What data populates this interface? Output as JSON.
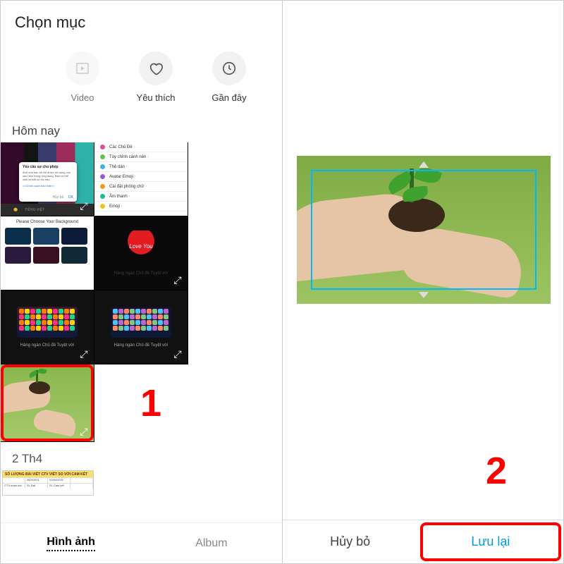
{
  "left": {
    "title": "Chọn mục",
    "categories": {
      "video": "Video",
      "favorites": "Yêu thích",
      "recent": "Gần đây"
    },
    "section_today": "Hôm nay",
    "dialog": {
      "title": "Yêu cầu sự cho phép",
      "body": "Ảnh của bạn sẽ chỉ được sử dụng cho các hình trong ứng dụng. Bạn có thể xóa nó bất cứ lúc nào.",
      "link": ">>Chính sách bảo mật<<",
      "cancel": "Hủy bỏ",
      "ok": "OK"
    },
    "bottom_bar_lang": "TIẾNG VIỆT",
    "settings_items": [
      {
        "color": "#e74c9b",
        "label": "Các Chủ Đề"
      },
      {
        "color": "#6fbf4b",
        "label": "Tùy chỉnh cảnh nền"
      },
      {
        "color": "#3fb0e8",
        "label": "Thẻ dán"
      },
      {
        "color": "#9b59d6",
        "label": "Avatar Emoji"
      },
      {
        "color": "#f39c12",
        "label": "Cài đặt phông chữ"
      },
      {
        "color": "#1abc9c",
        "label": "Âm thanh"
      },
      {
        "color": "#f1c40f",
        "label": "Emoji"
      }
    ],
    "bg_header": "Please Choose Your Background",
    "bg_colors": [
      "#0b2f4a",
      "#1a3f63",
      "#0d1b3a",
      "#2c1a3f",
      "#3a0f1f",
      "#102a38"
    ],
    "kbd_caption": "Hàng ngàn Chủ đề Tuyệt vời",
    "love_text": "Love You",
    "section_apr": "2 Th4",
    "sheet_title": "SỐ LƯỢNG BÀI VIẾT CTV VIẾT SO VỚI CAM KẾT",
    "sheet_cols": [
      "",
      "28/3/2021",
      "01/04/2021",
      ""
    ],
    "sheet_row": [
      "CTV nhân bài",
      "SL Đạt",
      "SL Cam kết",
      ""
    ],
    "tabs": {
      "images": "Hình ảnh",
      "album": "Album"
    },
    "step": "1"
  },
  "right": {
    "step": "2",
    "actions": {
      "cancel": "Hủy bỏ",
      "save": "Lưu lại"
    }
  }
}
